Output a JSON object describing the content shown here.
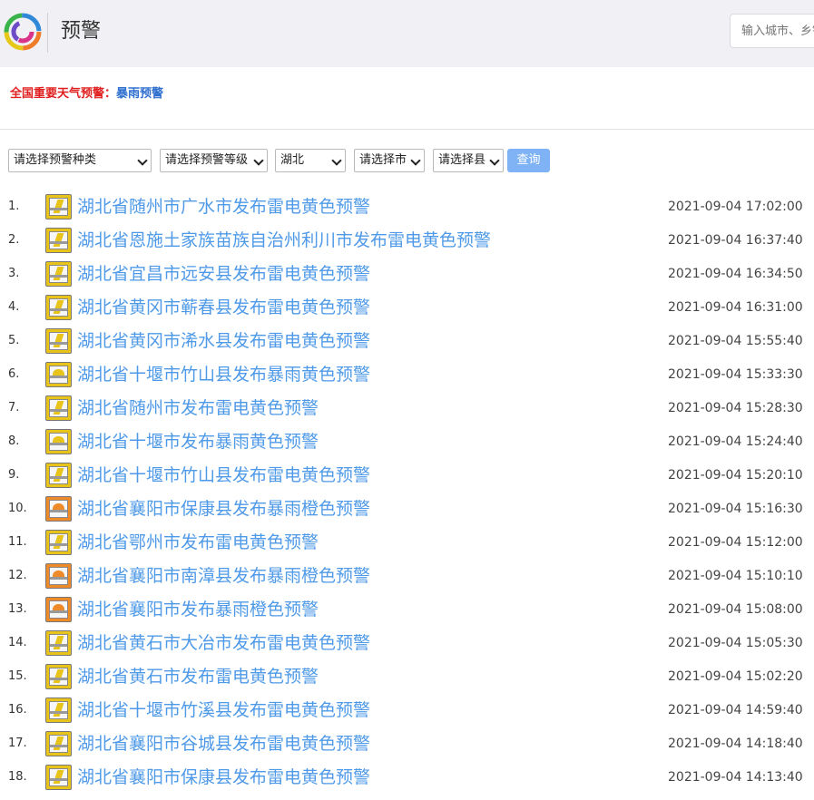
{
  "header": {
    "title": "预警",
    "search_placeholder": "输入城市、乡镇"
  },
  "alert": {
    "label": "全国重要天气预警：",
    "link": "暴雨预警"
  },
  "filters": {
    "type": "请选择预警种类",
    "level": "请选择预警等级",
    "province": "湖北",
    "city": "请选择市",
    "county": "请选择县",
    "query": "查询"
  },
  "warnings": [
    {
      "num": "1.",
      "title": "湖北省随州市广水市发布雷电黄色预警",
      "time": "2021-09-04 17:02:00",
      "icon": "thunder-yellow-icon"
    },
    {
      "num": "2.",
      "title": "湖北省恩施土家族苗族自治州利川市发布雷电黄色预警",
      "time": "2021-09-04 16:37:40",
      "icon": "thunder-yellow-icon"
    },
    {
      "num": "3.",
      "title": "湖北省宜昌市远安县发布雷电黄色预警",
      "time": "2021-09-04 16:34:50",
      "icon": "thunder-yellow-icon"
    },
    {
      "num": "4.",
      "title": "湖北省黄冈市蕲春县发布雷电黄色预警",
      "time": "2021-09-04 16:31:00",
      "icon": "thunder-yellow-icon"
    },
    {
      "num": "5.",
      "title": "湖北省黄冈市浠水县发布雷电黄色预警",
      "time": "2021-09-04 15:55:40",
      "icon": "thunder-yellow-icon"
    },
    {
      "num": "6.",
      "title": "湖北省十堰市竹山县发布暴雨黄色预警",
      "time": "2021-09-04 15:33:30",
      "icon": "rainstorm-yellow-icon"
    },
    {
      "num": "7.",
      "title": "湖北省随州市发布雷电黄色预警",
      "time": "2021-09-04 15:28:30",
      "icon": "thunder-yellow-icon"
    },
    {
      "num": "8.",
      "title": "湖北省十堰市发布暴雨黄色预警",
      "time": "2021-09-04 15:24:40",
      "icon": "rainstorm-yellow-icon"
    },
    {
      "num": "9.",
      "title": "湖北省十堰市竹山县发布雷电黄色预警",
      "time": "2021-09-04 15:20:10",
      "icon": "thunder-yellow-icon"
    },
    {
      "num": "10.",
      "title": "湖北省襄阳市保康县发布暴雨橙色预警",
      "time": "2021-09-04 15:16:30",
      "icon": "rainstorm-orange-icon"
    },
    {
      "num": "11.",
      "title": "湖北省鄂州市发布雷电黄色预警",
      "time": "2021-09-04 15:12:00",
      "icon": "thunder-yellow-icon"
    },
    {
      "num": "12.",
      "title": "湖北省襄阳市南漳县发布暴雨橙色预警",
      "time": "2021-09-04 15:10:10",
      "icon": "rainstorm-orange-icon"
    },
    {
      "num": "13.",
      "title": "湖北省襄阳市发布暴雨橙色预警",
      "time": "2021-09-04 15:08:00",
      "icon": "rainstorm-orange-icon"
    },
    {
      "num": "14.",
      "title": "湖北省黄石市大冶市发布雷电黄色预警",
      "time": "2021-09-04 15:05:30",
      "icon": "thunder-yellow-icon"
    },
    {
      "num": "15.",
      "title": "湖北省黄石市发布雷电黄色预警",
      "time": "2021-09-04 15:02:20",
      "icon": "thunder-yellow-icon"
    },
    {
      "num": "16.",
      "title": "湖北省十堰市竹溪县发布雷电黄色预警",
      "time": "2021-09-04 14:59:40",
      "icon": "thunder-yellow-icon"
    },
    {
      "num": "17.",
      "title": "湖北省襄阳市谷城县发布雷电黄色预警",
      "time": "2021-09-04 14:18:40",
      "icon": "thunder-yellow-icon"
    },
    {
      "num": "18.",
      "title": "湖北省襄阳市保康县发布雷电黄色预警",
      "time": "2021-09-04 14:13:40",
      "icon": "thunder-yellow-icon"
    }
  ],
  "colors": {
    "accent_link": "#4f9ae8",
    "alert_red": "#e02020",
    "query_button": "#7fb3f5",
    "yellow_warning": "#e8c31a",
    "orange_warning": "#ee8a2a"
  }
}
